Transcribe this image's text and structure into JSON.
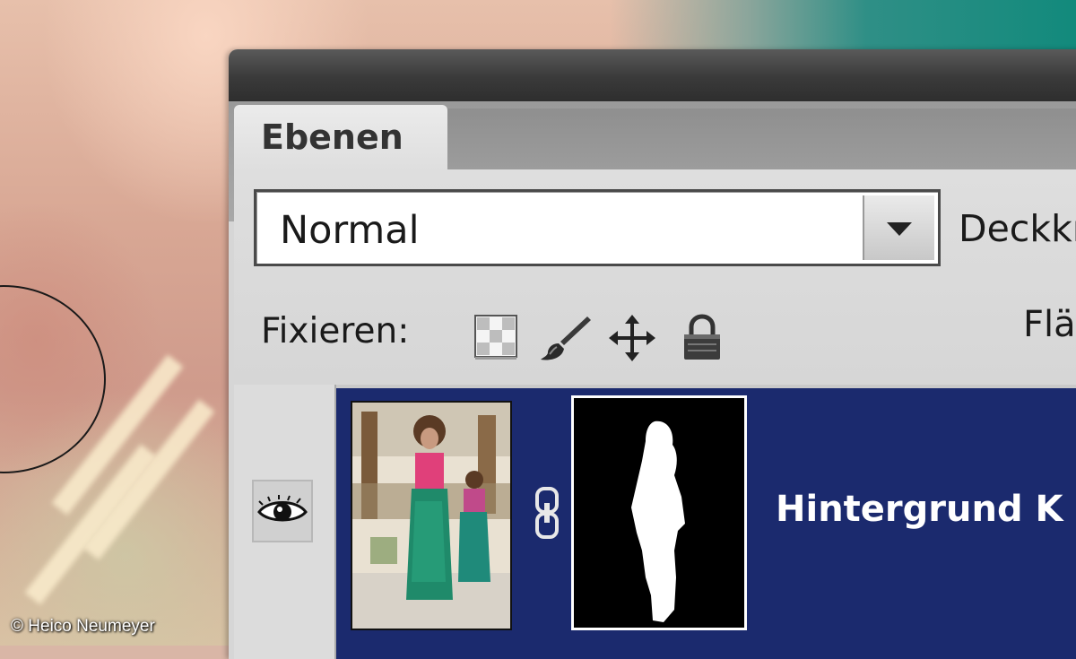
{
  "panel": {
    "tab_label": "Ebenen",
    "blend_mode": {
      "value": "Normal"
    },
    "opacity_label": "Deckkr",
    "lock": {
      "label": "Fixieren:",
      "icons": [
        "transparency-lock-icon",
        "brush-lock-icon",
        "move-lock-icon",
        "padlock-icon"
      ]
    },
    "fill_label": "Flä",
    "layers": [
      {
        "name": "Hintergrund K",
        "visible": true,
        "selected": true,
        "has_mask": true
      }
    ]
  },
  "credit": "© Heico Neumeyer",
  "colors": {
    "selected_row": "#1b2a6e",
    "panel_bg": "#d6d6d6",
    "title_bar": "#3a3a3a"
  }
}
